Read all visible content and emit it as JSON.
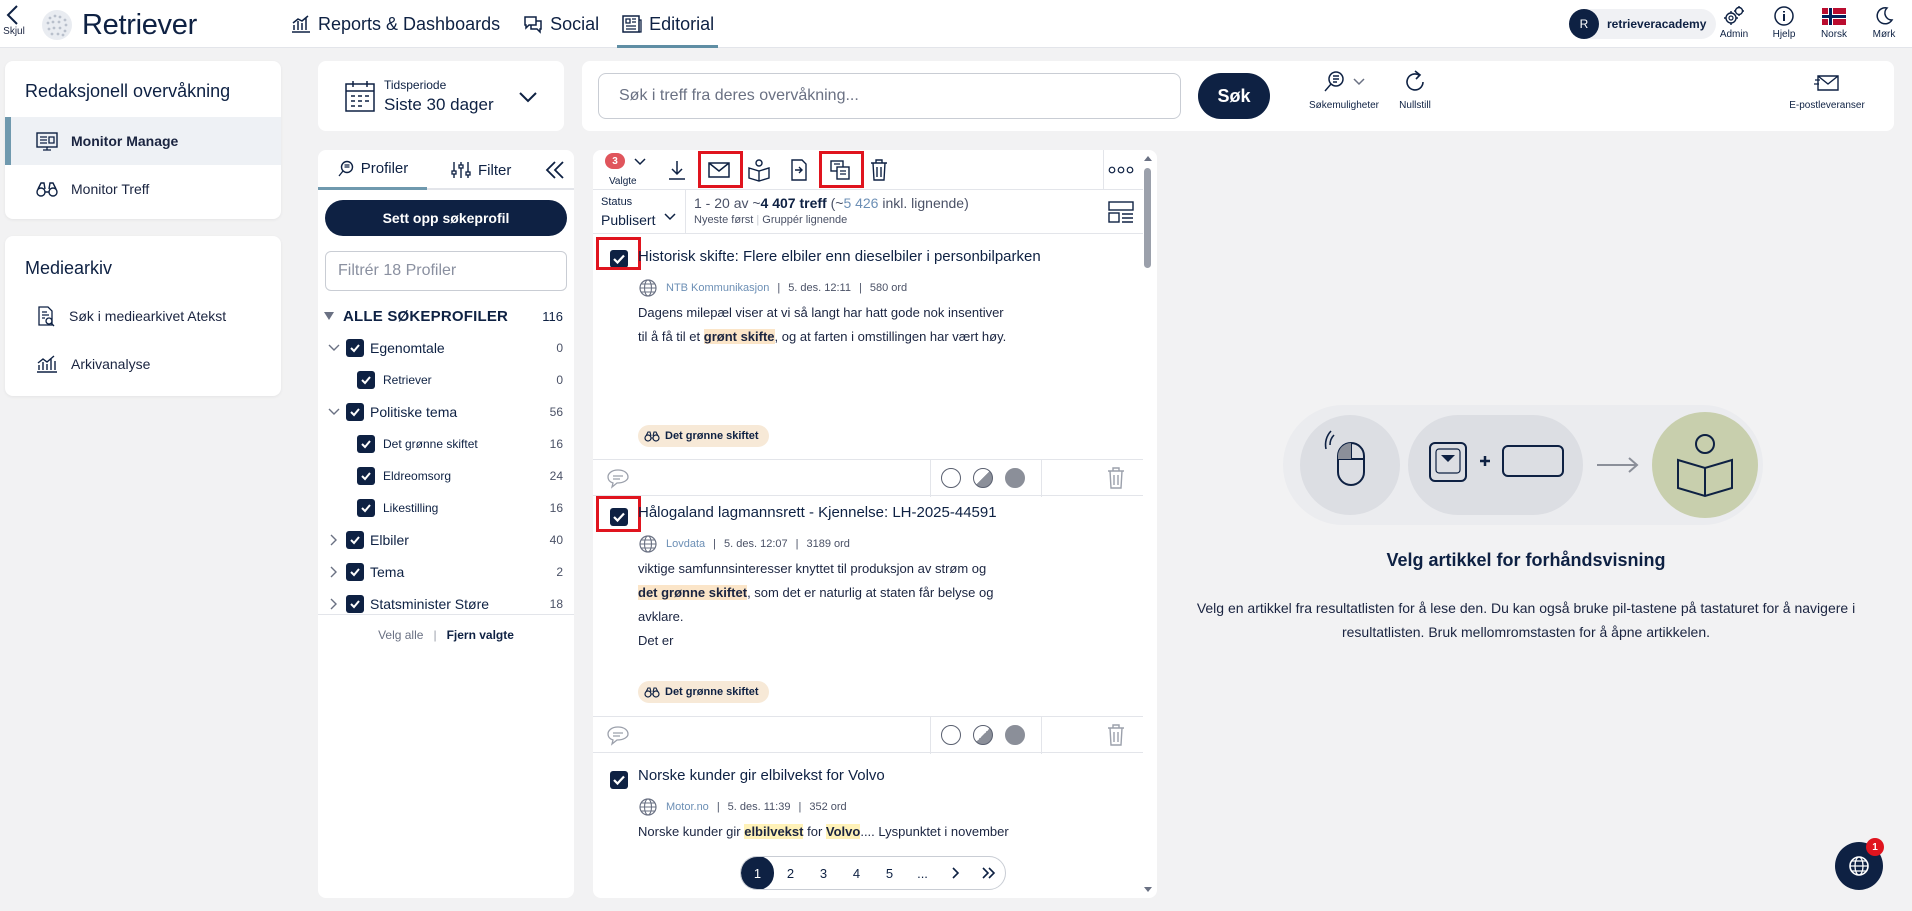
{
  "topbar": {
    "hide_label": "Skjul",
    "logo_text": "Retriever",
    "nav": [
      {
        "label": "Reports & Dashboards",
        "icon": "chart-icon"
      },
      {
        "label": "Social",
        "icon": "chat-bubbles-icon"
      },
      {
        "label": "Editorial",
        "icon": "newspaper-icon",
        "active": true
      }
    ],
    "account": {
      "initial": "R",
      "name": "retrieveracademy"
    },
    "icons": [
      {
        "label": "Admin",
        "icon": "gears-icon"
      },
      {
        "label": "Hjelp",
        "icon": "info-icon"
      },
      {
        "label": "Norsk",
        "icon": "norway-flag-icon"
      },
      {
        "label": "Mørk",
        "icon": "moon-icon"
      }
    ]
  },
  "sidebar": {
    "section1": {
      "title": "Redaksjonell overvåkning",
      "items": [
        {
          "label": "Monitor Manage",
          "active": true
        },
        {
          "label": "Monitor Treff"
        }
      ]
    },
    "section2": {
      "title": "Mediearkiv",
      "items": [
        {
          "label": "Søk i mediearkivet Atekst"
        },
        {
          "label": "Arkivanalyse"
        }
      ]
    }
  },
  "period": {
    "label": "Tidsperiode",
    "value": "Siste 30 dager"
  },
  "search": {
    "placeholder": "Søk i treff fra deres overvåkning...",
    "button": "Søk",
    "options_label": "Søkemuligheter",
    "reset_label": "Nullstill",
    "email_label": "E-postleveranser"
  },
  "profiles": {
    "tab_profiles": "Profiler",
    "tab_filter": "Filter",
    "setup_button": "Sett opp søkeprofil",
    "filter_placeholder": "Filtrér 18 Profiler",
    "all_label": "ALLE SØKEPROFILER",
    "all_count": "116",
    "tree": [
      {
        "label": "Egenomtale",
        "count": "0",
        "level": 0,
        "expanded": true
      },
      {
        "label": "Retriever",
        "count": "0",
        "level": 1
      },
      {
        "label": "Politiske tema",
        "count": "56",
        "level": 0,
        "expanded": true
      },
      {
        "label": "Det grønne skiftet",
        "count": "16",
        "level": 1
      },
      {
        "label": "Eldreomsorg",
        "count": "24",
        "level": 1
      },
      {
        "label": "Likestilling",
        "count": "16",
        "level": 1
      },
      {
        "label": "Elbiler",
        "count": "40",
        "level": 0,
        "expanded": false
      },
      {
        "label": "Tema",
        "count": "2",
        "level": 0,
        "expanded": false
      },
      {
        "label": "Statsminister Støre",
        "count": "18",
        "level": 0,
        "expanded": false
      }
    ],
    "select_all": "Velg alle",
    "deselect": "Fjern valgte"
  },
  "results": {
    "selected_count": "3",
    "selected_label": "Valgte",
    "status_label": "Status",
    "status_value": "Publisert",
    "range": "1 - 20 av ~",
    "total": "4 407 treff",
    "similar_open": "(~",
    "similar_count": "5 426",
    "similar_rest": " inkl. lignende)",
    "sort": "Nyeste først",
    "group": "Gruppér lignende",
    "articles": [
      {
        "title": "Historisk skifte: Flere elbiler enn dieselbiler i personbilparken",
        "source": "NTB Kommunikasjon",
        "date": "5. des. 12:11",
        "words": "580 ord",
        "body1": "Dagens milepæl viser at vi så langt har hatt gode nok insentiver",
        "body2a": "til å få til et ",
        "body2hl": "grønt skifte",
        "body2b": ", og at farten i omstillingen har vært høy.",
        "tag": "Det grønne skiftet"
      },
      {
        "title": "Hålogaland lagmannsrett - Kjennelse: LH-2025-44591",
        "source": "Lovdata",
        "date": "5. des. 12:07",
        "words": "3189 ord",
        "body1": "viktige samfunnsinteresser knyttet til produksjon av strøm og",
        "body2hl": "det grønne skiftet",
        "body2b": ", som det er naturlig at staten får belyse og",
        "body3": "avklare.",
        "body4": "Det er",
        "tag": "Det grønne skiftet"
      },
      {
        "title": "Norske kunder gir elbilvekst for Volvo",
        "source": "Motor.no",
        "date": "5. des. 11:39",
        "words": "352 ord",
        "body1a": "Norske kunder gir ",
        "body1hl": "elbilvekst",
        "body1b": " for ",
        "body1hl2": "Volvo",
        "body1c": ".... Lyspunktet i november"
      }
    ],
    "pages": [
      "1",
      "2",
      "3",
      "4",
      "5",
      "..."
    ]
  },
  "preview": {
    "title": "Velg artikkel for forhåndsvisning",
    "text": "Velg en artikkel fra resultatlisten for å lese den. Du kan også bruke pil-tastene på tastaturet for å navigere i resultatlisten. Bruk mellomromstasten for å åpne artikkelen."
  },
  "chat": {
    "badge": "1"
  }
}
